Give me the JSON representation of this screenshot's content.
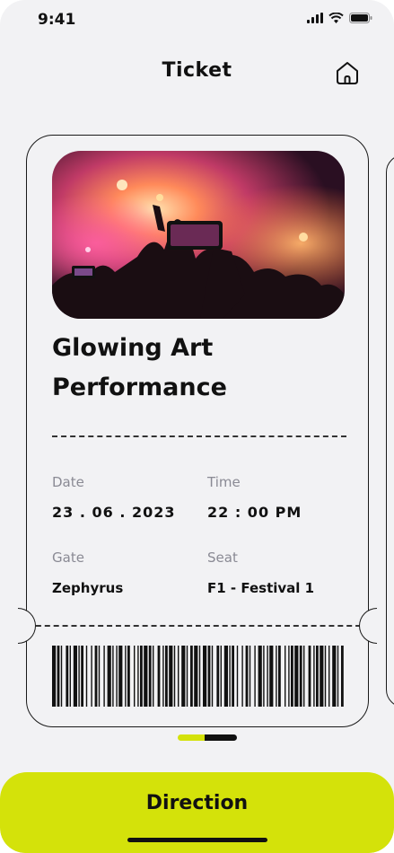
{
  "status_bar": {
    "time": "9:41"
  },
  "header": {
    "title": "Ticket"
  },
  "ticket": {
    "event_title": "Glowing Art Performance",
    "date": {
      "label": "Date",
      "value": "23 . 06 . 2023"
    },
    "time": {
      "label": "Time",
      "value": "22 : 00 PM"
    },
    "gate": {
      "label": "Gate",
      "value": "Zephyrus"
    },
    "seat": {
      "label": "Seat",
      "value": "F1 - Festival 1"
    }
  },
  "pager": {
    "current": 1
  },
  "actions": {
    "direction_label": "Direction"
  },
  "colors": {
    "accent": "#d4e20a",
    "background": "#f2f2f4",
    "ink": "#111111"
  },
  "icons": [
    "signal-icon",
    "wifi-icon",
    "battery-icon",
    "home-icon"
  ]
}
